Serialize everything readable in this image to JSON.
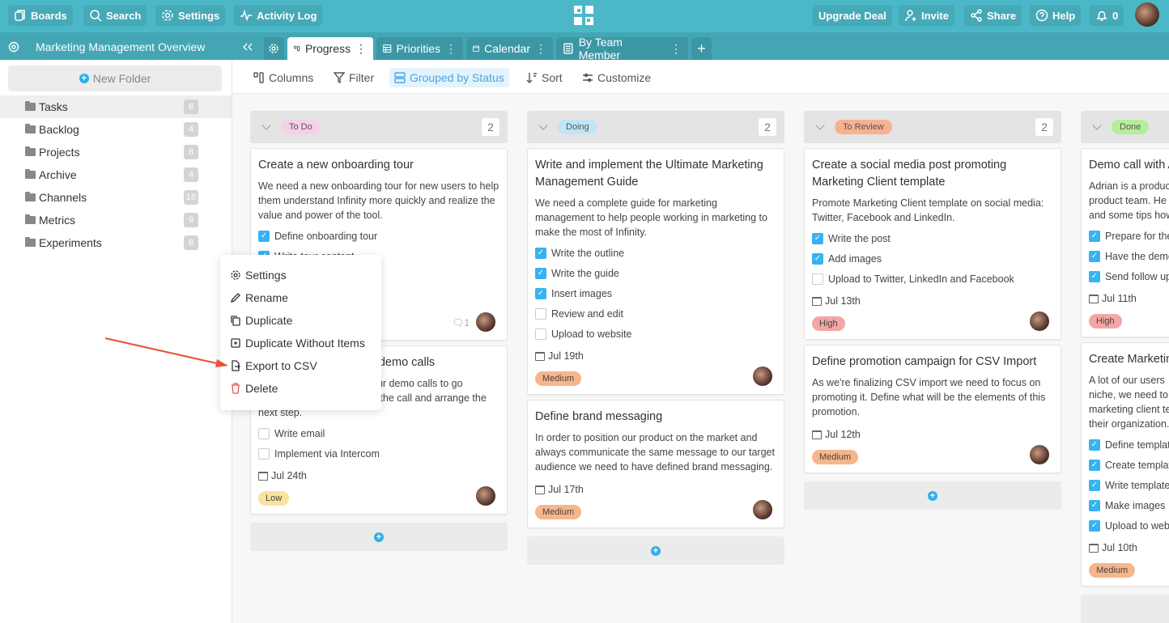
{
  "topbar": {
    "boards": "Boards",
    "search": "Search",
    "settings": "Settings",
    "activity_log": "Activity Log",
    "upgrade": "Upgrade Deal",
    "invite": "Invite",
    "share": "Share",
    "help": "Help",
    "notifications": "0"
  },
  "board": {
    "title": "Marketing Management Overview"
  },
  "tabs": [
    {
      "label": "Progress"
    },
    {
      "label": "Priorities"
    },
    {
      "label": "Calendar"
    },
    {
      "label": "By Team Member"
    }
  ],
  "sidebar": {
    "new_folder": "New Folder",
    "items": [
      {
        "label": "Tasks",
        "count": "8"
      },
      {
        "label": "Backlog",
        "count": "4"
      },
      {
        "label": "Projects",
        "count": "8"
      },
      {
        "label": "Archive",
        "count": "4"
      },
      {
        "label": "Channels",
        "count": "16"
      },
      {
        "label": "Metrics",
        "count": "9"
      },
      {
        "label": "Experiments",
        "count": "8"
      }
    ]
  },
  "toolbar": {
    "columns": "Columns",
    "filter": "Filter",
    "grouped": "Grouped by Status",
    "sort": "Sort",
    "customize": "Customize"
  },
  "colors": {
    "topbar": "#4bb8c7",
    "accent": "#36b3f0",
    "todo": "#f6d0ea",
    "doing": "#bfe6f7",
    "review": "#f7b190",
    "done": "#b7ec9b",
    "high": "#f4a5a5",
    "medium": "#f7b58c",
    "low": "#fbe1a0"
  },
  "columns": [
    {
      "status": "To Do",
      "count": "2",
      "color": "#f6d0ea",
      "cards": [
        {
          "title": "Create a new onboarding tour",
          "desc": "We need a new onboarding tour for new users to help them understand Infinity more quickly and realize the value and power of the tool.",
          "checks": [
            {
              "label": "Define onboarding tour",
              "done": true
            },
            {
              "label": "Write tour content",
              "done": true
            }
          ],
          "comments": "1",
          "minh": 238
        },
        {
          "title": "r demo calls",
          "desc_fragments": [
            "our demo calls to go",
            "n the call and arrange the"
          ],
          "desc": "next step.",
          "checks": [
            {
              "label": "Write email",
              "done": false
            },
            {
              "label": "Implement via Intercom",
              "done": false
            }
          ],
          "date": "Jul 24th",
          "priority": "Low",
          "priority_color": "#fbe1a0"
        }
      ]
    },
    {
      "status": "Doing",
      "count": "2",
      "color": "#bfe6f7",
      "cards": [
        {
          "title": "Write and implement the Ultimate Marketing Management Guide",
          "desc": "We need a complete guide for marketing management to help people working in marketing to make the most of Infinity.",
          "checks": [
            {
              "label": "Write the outline",
              "done": true
            },
            {
              "label": "Write the guide",
              "done": true
            },
            {
              "label": "Insert images",
              "done": true
            },
            {
              "label": "Review and edit",
              "done": false
            },
            {
              "label": "Upload to website",
              "done": false
            }
          ],
          "date": "Jul 19th",
          "priority": "Medium",
          "priority_color": "#f7b58c"
        },
        {
          "title": "Define brand messaging",
          "desc": "In order to position our product on the market and always communicate the same message to our target audience we need to have defined brand messaging.",
          "checks": [],
          "date": "Jul 17th",
          "priority": "Medium",
          "priority_color": "#f7b58c"
        }
      ]
    },
    {
      "status": "To Review",
      "count": "2",
      "color": "#f7b190",
      "cards": [
        {
          "title": "Create a social media post promoting Marketing Client template",
          "desc": "Promote Marketing Client template on social media: Twitter, Facebook and LinkedIn.",
          "checks": [
            {
              "label": "Write the post",
              "done": true
            },
            {
              "label": "Add images",
              "done": true
            },
            {
              "label": "Upload to Twitter, LinkedIn and Facebook",
              "done": false
            }
          ],
          "date": "Jul 13th",
          "priority": "High",
          "priority_color": "#f4a5a5"
        },
        {
          "title": "Define promotion campaign for CSV Import",
          "desc": "As we're finalizing CSV import we need to focus on promoting it. Define what will be the elements of this promotion.",
          "checks": [],
          "date": "Jul 12th",
          "priority": "Medium",
          "priority_color": "#f7b58c"
        }
      ]
    },
    {
      "status": "Done",
      "count": "",
      "color": "#b7ec9b",
      "cards": [
        {
          "title": "Demo call with A",
          "desc_lines": [
            "Adrian is a produc",
            "product team. He",
            "and some tips how"
          ],
          "checks": [
            {
              "label": "Prepare for the",
              "done": true
            },
            {
              "label": "Have the demo",
              "done": true
            },
            {
              "label": "Send follow up",
              "done": true
            }
          ],
          "date": "Jul 11th",
          "priority": "High",
          "priority_color": "#f4a5a5"
        },
        {
          "title": "Create Marketin",
          "desc_lines": [
            "A lot of our users",
            "niche, we need to",
            "marketing client te",
            "their organization."
          ],
          "checks": [
            {
              "label": "Define templat",
              "done": true
            },
            {
              "label": "Create templat",
              "done": true
            },
            {
              "label": "Write template",
              "done": true
            },
            {
              "label": "Make images",
              "done": true
            },
            {
              "label": "Upload to web",
              "done": true
            }
          ],
          "date": "Jul 10th",
          "priority": "Medium",
          "priority_color": "#f7b58c"
        }
      ]
    }
  ],
  "context_menu": {
    "items": [
      {
        "label": "Settings",
        "icon": "gear-icon"
      },
      {
        "label": "Rename",
        "icon": "pencil-icon"
      },
      {
        "label": "Duplicate",
        "icon": "copy-icon"
      },
      {
        "label": "Duplicate Without Items",
        "icon": "copy-plus-icon"
      },
      {
        "label": "Export to CSV",
        "icon": "file-export-icon"
      },
      {
        "label": "Delete",
        "icon": "trash-icon"
      }
    ]
  }
}
